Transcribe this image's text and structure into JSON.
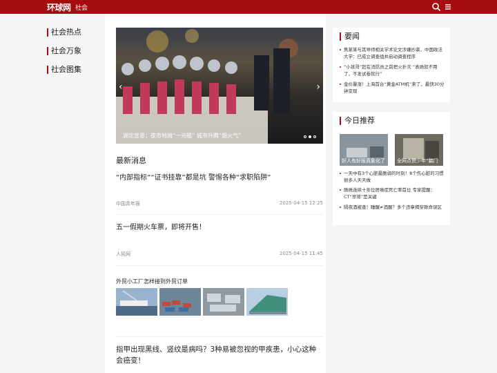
{
  "header": {
    "logo": "环球网",
    "channel": "社会",
    "search_icon": "search-icon",
    "menu_icon": "menu-icon"
  },
  "leftnav": {
    "items": [
      {
        "label": "社会热点"
      },
      {
        "label": "社会万象"
      },
      {
        "label": "社会图集"
      }
    ]
  },
  "slider": {
    "caption": "湖北宣恩：夜市地摊“一元租” 城市升腾“烟火气”",
    "active_index": 1,
    "count": 3
  },
  "latest": {
    "section_title": "最新消息",
    "items": [
      {
        "title": "“内部指标”“证书挂靠”都是坑 警惕各种“求职陷阱”",
        "source": "中国青年报",
        "time": "2025-04-15 12:25"
      },
      {
        "title": "五一假期火车票，即将开售！",
        "source": "人民网",
        "time": "2025-04-15 11:45"
      }
    ],
    "gallery_title": "外贸小工厂怎样接到外贸订单",
    "last_item_title": "指甲出现黑线、竖纹是病吗？3种易被忽视的甲疾患，小心这种会癌变！"
  },
  "yaowen": {
    "title": "要闻",
    "items": [
      {
        "text": "焦某某与其导师相关学术论文涉嫌抄袭，中国政法大学：已成立调查组并启动调查程序"
      },
      {
        "text": "“小孩哥”赶在消防员之前把火扑灭 “表扬就不用了，不发试卷就行”"
      },
      {
        "text": "金价暴涨！上海首台“黄金ATM机”来了，最快30分钟变现"
      }
    ]
  },
  "today": {
    "title": "今日推荐",
    "images": [
      {
        "caption": "好人有好报真象化了"
      },
      {
        "caption": "全网点赞少年“踹门"
      }
    ],
    "items": [
      {
        "text": "一天中有3个心脏最脆弱的时刻！8个伤心脏的习惯很多人天天做"
      },
      {
        "text": "肠癌连续十年位居癌症死亡率首位 专家提醒：CT“早筛”是关键"
      },
      {
        "text": "隔夜酒被查！睡醒≠酒醒？多个违章揭穿致命误区"
      }
    ]
  }
}
